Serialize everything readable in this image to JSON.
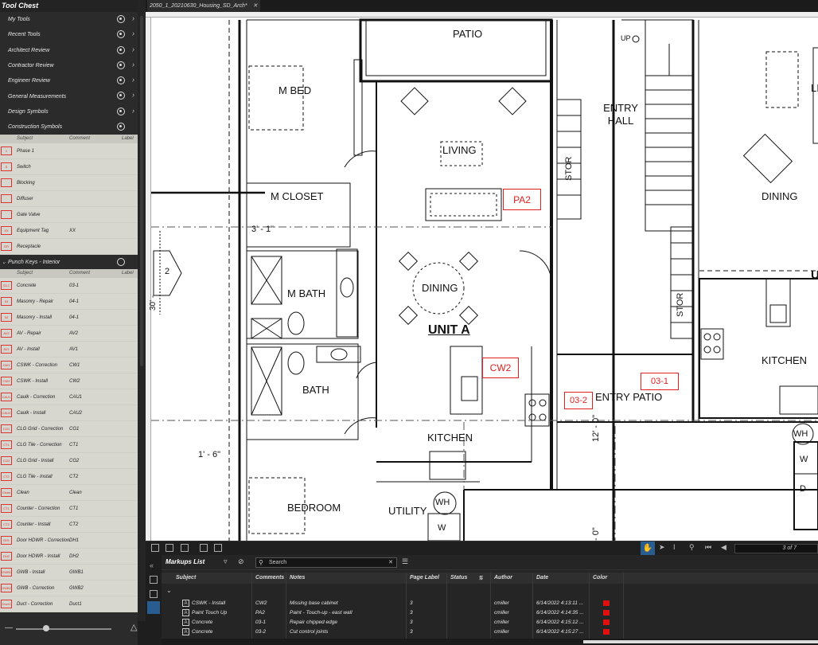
{
  "tool_chest": {
    "title": "Tool Chest",
    "items": [
      "My Tools",
      "Recent Tools",
      "Architect Review",
      "Contractor Review",
      "Engineer Review",
      "General Measurements",
      "Design Symbols",
      "Construction Symbols"
    ],
    "columns": {
      "subject": "Subject",
      "comment": "Comment",
      "label": "Label"
    },
    "construction_symbols": [
      {
        "subject": "Phase 1",
        "comment": "",
        "icon": "1"
      },
      {
        "subject": "Switch",
        "comment": "",
        "icon": "S"
      },
      {
        "subject": "Blocking",
        "comment": "",
        "icon": ""
      },
      {
        "subject": "Diffuser",
        "comment": "",
        "icon": ""
      },
      {
        "subject": "Gate Valve",
        "comment": "",
        "icon": ""
      },
      {
        "subject": "Equipment Tag",
        "comment": "XX",
        "icon": "XX"
      },
      {
        "subject": "Receptacle",
        "comment": "",
        "icon": "GFI"
      }
    ],
    "punch_keys_title": "Punch Keys - Interior",
    "punch_keys": [
      {
        "subject": "Concrete",
        "comment": "03-1",
        "icon": "03-1"
      },
      {
        "subject": "Masonry - Repair",
        "comment": "04-1",
        "icon": "04"
      },
      {
        "subject": "Masonry - Install",
        "comment": "04-1",
        "icon": "04"
      },
      {
        "subject": "AV - Repair",
        "comment": "AV2",
        "icon": "AV2"
      },
      {
        "subject": "AV - Install",
        "comment": "AV1",
        "icon": "AV1"
      },
      {
        "subject": "CSWK - Correction",
        "comment": "CW1",
        "icon": "CW1"
      },
      {
        "subject": "CSWK - Install",
        "comment": "CW2",
        "icon": "CW2"
      },
      {
        "subject": "Caulk - Correction",
        "comment": "CAU1",
        "icon": "CAU1"
      },
      {
        "subject": "Caulk - Install",
        "comment": "CAU2",
        "icon": "CAU2"
      },
      {
        "subject": "CLG Grid - Correction",
        "comment": "CG1",
        "icon": "CG1"
      },
      {
        "subject": "CLG Tile - Correction",
        "comment": "CT1",
        "icon": "CT1"
      },
      {
        "subject": "CLG Grid - Install",
        "comment": "CG2",
        "icon": "CG2"
      },
      {
        "subject": "CLG Tile - Install",
        "comment": "CT2",
        "icon": "CT2"
      },
      {
        "subject": "Clean",
        "comment": "Clean",
        "icon": "Clean"
      },
      {
        "subject": "Counter - Correction",
        "comment": "CT1",
        "icon": "CT1"
      },
      {
        "subject": "Counter - Install",
        "comment": "CT2",
        "icon": "CT2"
      },
      {
        "subject": "Door HDWR - Correction",
        "comment": "DH1",
        "icon": "DH1"
      },
      {
        "subject": "Door HDWR - Install",
        "comment": "DH2",
        "icon": "DH2"
      },
      {
        "subject": "GWB - Install",
        "comment": "GWB1",
        "icon": "GWB1"
      },
      {
        "subject": "GWB - Correction",
        "comment": "GWB2",
        "icon": "GWB2"
      },
      {
        "subject": "Duct - Correction",
        "comment": "Duct1",
        "icon": "Duct1"
      }
    ]
  },
  "document": {
    "tab_title": "2050_1_20210630_Housing_SD_Arch*"
  },
  "drawing": {
    "rooms": {
      "patio": "PATIO",
      "m_bed": "M BED",
      "living": "LIVING",
      "m_closet": "M CLOSET",
      "dim_3_1": "3' - 1\"",
      "m_bath": "M BATH",
      "dining": "DINING",
      "unit_a": "UNIT A",
      "bath": "BATH",
      "kitchen": "KITCHEN",
      "dim_1_6": "1' - 6\"",
      "bedroom": "BEDROOM",
      "utility": "UTILITY",
      "wh": "WH",
      "w": "W",
      "stor": "STOR",
      "entry_hall": "ENTRY HALL",
      "up": "UP",
      "entry_patio": "ENTRY PATIO",
      "dim_12_0": "12' - 0\"",
      "dim_0": "- 0\"",
      "dining_right": "DINING",
      "kitchen_right": "KITCHEN",
      "stor_right": "STOR",
      "wh_right": "WH",
      "w_right": "W",
      "d_right": "D",
      "tag_2": "2",
      "dim_30": "30' -",
      "cut_l": "LI",
      "cut_u": "U"
    },
    "markups": {
      "pa2": "PA2",
      "cw2": "CW2",
      "m03_1": "03-1",
      "m03_2": "03-2"
    }
  },
  "navigation": {
    "page_indicator": "3 of 7"
  },
  "markups_list": {
    "title": "Markups List",
    "search_placeholder": "Search",
    "columns": {
      "subject": "Subject",
      "comments": "Comments",
      "notes": "Notes",
      "page_label": "Page Label",
      "status": "Status",
      "author": "Author",
      "date": "Date",
      "color": "Color"
    },
    "rows": [
      {
        "subject": "CSWK - Install",
        "comments": "CW2",
        "notes": "Missing base cabinet",
        "page": "3",
        "status": "",
        "author": "cmiller",
        "date": "6/14/2022 4:13:11 ...",
        "color": "#e01010"
      },
      {
        "subject": "Paint Touch Up",
        "comments": "PA2",
        "notes": "Paint - Touch-up - east wall",
        "page": "3",
        "status": "",
        "author": "cmiller",
        "date": "6/14/2022 4:14:35 ...",
        "color": "#e01010"
      },
      {
        "subject": "Concrete",
        "comments": "03-1",
        "notes": "Repair chipped edge",
        "page": "3",
        "status": "",
        "author": "cmiller",
        "date": "6/14/2022 4:15:12 ...",
        "color": "#e01010"
      },
      {
        "subject": "Concrete",
        "comments": "03-2",
        "notes": "Cut control joints",
        "page": "3",
        "status": "",
        "author": "cmiller",
        "date": "6/14/2022 4:15:27 ...",
        "color": "#e01010"
      }
    ]
  }
}
